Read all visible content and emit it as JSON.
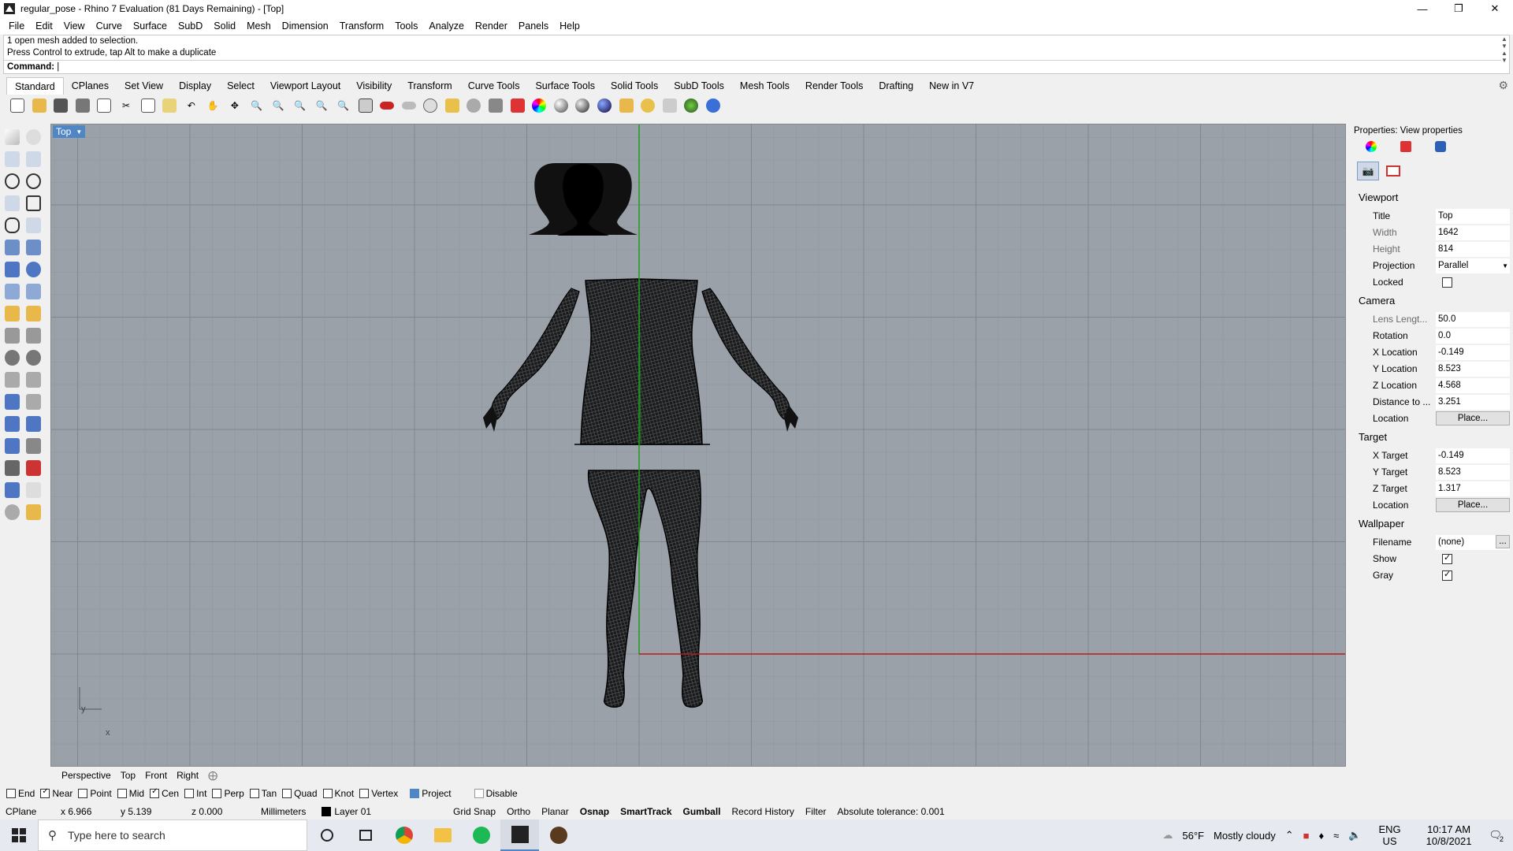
{
  "window": {
    "title": "regular_pose - Rhino 7 Evaluation (81 Days Remaining) - [Top]"
  },
  "menu": [
    "File",
    "Edit",
    "View",
    "Curve",
    "Surface",
    "SubD",
    "Solid",
    "Mesh",
    "Dimension",
    "Transform",
    "Tools",
    "Analyze",
    "Render",
    "Panels",
    "Help"
  ],
  "command": {
    "history_line1": "1 open mesh added to selection.",
    "history_line2": "Press Control to extrude, tap Alt to make a duplicate",
    "prompt_label": "Command:",
    "value": ""
  },
  "toolbar_tabs": [
    "Standard",
    "CPlanes",
    "Set View",
    "Display",
    "Select",
    "Viewport Layout",
    "Visibility",
    "Transform",
    "Curve Tools",
    "Surface Tools",
    "Solid Tools",
    "SubD Tools",
    "Mesh Tools",
    "Render Tools",
    "Drafting",
    "New in V7"
  ],
  "viewport": {
    "label": "Top",
    "axis_y": "y",
    "axis_x": "x"
  },
  "viewport_tabs": [
    "Perspective",
    "Top",
    "Front",
    "Right"
  ],
  "properties": {
    "title": "Properties: View properties",
    "sections": {
      "viewport": "Viewport",
      "camera": "Camera",
      "target": "Target",
      "wallpaper": "Wallpaper"
    },
    "viewport_rows": [
      {
        "label": "Title",
        "value": "Top"
      },
      {
        "label": "Width",
        "value": "1642"
      },
      {
        "label": "Height",
        "value": "814"
      },
      {
        "label": "Projection",
        "value": "Parallel"
      },
      {
        "label": "Locked",
        "value": ""
      }
    ],
    "camera_rows": [
      {
        "label": "Lens Lengt...",
        "value": "50.0"
      },
      {
        "label": "Rotation",
        "value": "0.0"
      },
      {
        "label": "X Location",
        "value": "-0.149"
      },
      {
        "label": "Y Location",
        "value": "8.523"
      },
      {
        "label": "Z Location",
        "value": "4.568"
      },
      {
        "label": "Distance to ...",
        "value": "3.251"
      },
      {
        "label": "Location",
        "value": "Place..."
      }
    ],
    "target_rows": [
      {
        "label": "X Target",
        "value": "-0.149"
      },
      {
        "label": "Y Target",
        "value": "8.523"
      },
      {
        "label": "Z Target",
        "value": "1.317"
      },
      {
        "label": "Location",
        "value": "Place..."
      }
    ],
    "wallpaper_rows": [
      {
        "label": "Filename",
        "value": "(none)"
      },
      {
        "label": "Show",
        "value": ""
      },
      {
        "label": "Gray",
        "value": ""
      }
    ],
    "filename_button": "..."
  },
  "osnaps": [
    {
      "label": "End",
      "on": false
    },
    {
      "label": "Near",
      "on": true
    },
    {
      "label": "Point",
      "on": false
    },
    {
      "label": "Mid",
      "on": false
    },
    {
      "label": "Cen",
      "on": true
    },
    {
      "label": "Int",
      "on": false
    },
    {
      "label": "Perp",
      "on": false
    },
    {
      "label": "Tan",
      "on": false
    },
    {
      "label": "Quad",
      "on": false
    },
    {
      "label": "Knot",
      "on": false
    },
    {
      "label": "Vertex",
      "on": false
    },
    {
      "label": "Project",
      "on": true
    },
    {
      "label": "Disable",
      "on": false
    }
  ],
  "status": {
    "cplane": "CPlane",
    "x": "x 6.966",
    "y": "y 5.139",
    "z": "z 0.000",
    "units": "Millimeters",
    "layer": "Layer 01",
    "grid_snap": "Grid Snap",
    "ortho": "Ortho",
    "planar": "Planar",
    "osnap": "Osnap",
    "smarttrack": "SmartTrack",
    "gumball": "Gumball",
    "record_history": "Record History",
    "filter": "Filter",
    "tolerance": "Absolute tolerance: 0.001"
  },
  "taskbar": {
    "search_placeholder": "Type here to search",
    "weather_temp": "56°F",
    "weather_desc": "Mostly cloudy",
    "lang": "ENG",
    "region": "US",
    "time": "10:17 AM",
    "date": "10/8/2021",
    "notifications": "2"
  },
  "colors": {
    "accent": "#4f86c6",
    "viewport_bg": "#9aa1a9",
    "x_axis": "#b41e1e",
    "y_axis": "#1e9e1e"
  }
}
